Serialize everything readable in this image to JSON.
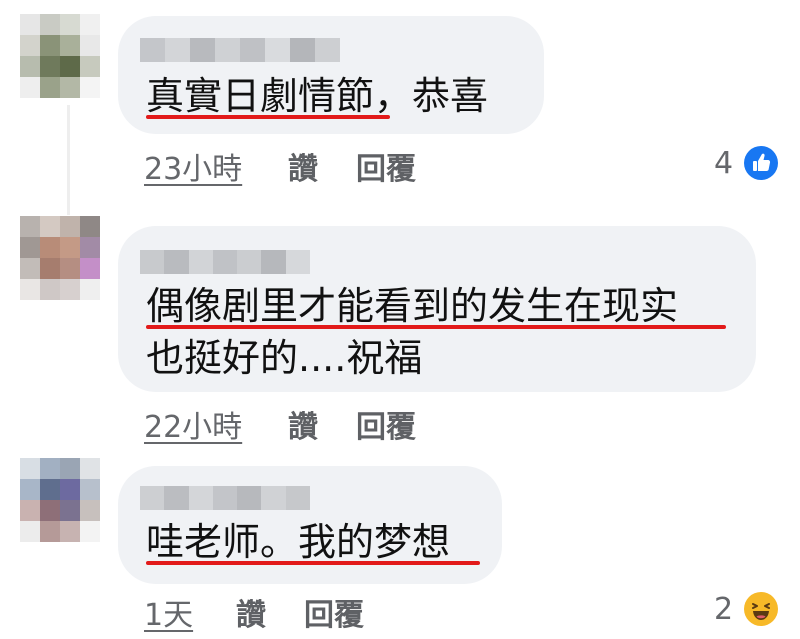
{
  "comments": [
    {
      "text_lines": [
        "真實日劇情節，恭喜"
      ],
      "time": "23小時",
      "like_label": "讚",
      "reply_label": "回覆",
      "reaction": {
        "count": "4",
        "icon": "thumbs-up-icon",
        "color": "#1877f2"
      }
    },
    {
      "text_lines": [
        "偶像剧里才能看到的发生在现实",
        "也挺好的....祝福"
      ],
      "time": "22小時",
      "like_label": "讚",
      "reply_label": "回覆"
    },
    {
      "text_lines": [
        "哇老师。我的梦想"
      ],
      "time": "1天",
      "like_label": "讚",
      "reply_label": "回覆",
      "reaction": {
        "count": "2",
        "icon": "haha-emoji-icon",
        "color": "#f7b928"
      }
    }
  ],
  "colors": {
    "bubble": "#f0f2f5",
    "underline": "#e21a1a",
    "meta_text": "#65676b"
  }
}
